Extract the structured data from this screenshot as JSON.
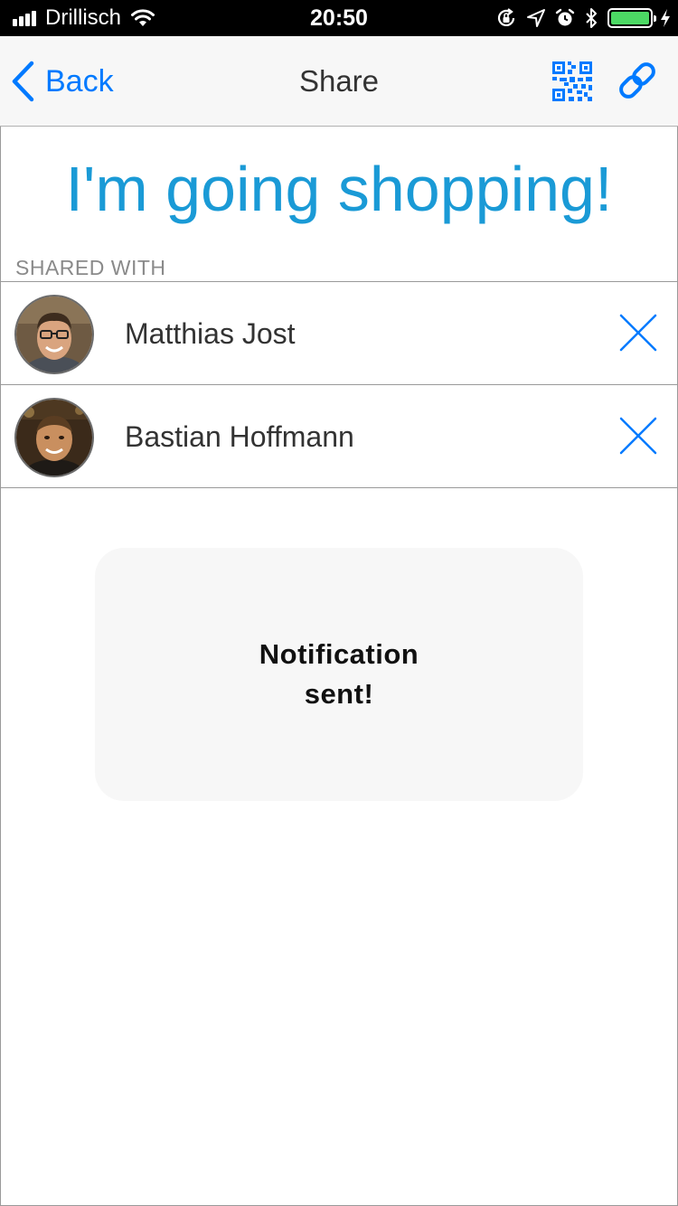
{
  "status_bar": {
    "carrier": "Drillisch",
    "time": "20:50",
    "signal_icon": "signal-bars-icon",
    "wifi_icon": "wifi-icon",
    "icons": [
      "orientation-lock-icon",
      "location-arrow-icon",
      "alarm-icon",
      "bluetooth-icon",
      "battery-icon",
      "charging-bolt-icon"
    ],
    "battery_level": 1.0,
    "battery_color": "#4cd964"
  },
  "nav": {
    "back_label": "Back",
    "title": "Share",
    "qr_icon": "qr-code-icon",
    "link_icon": "link-icon"
  },
  "list": {
    "title": "I'm going shopping!",
    "title_color": "#1a9ad6"
  },
  "shared_with": {
    "header": "SHARED WITH",
    "people": [
      {
        "name": "Matthias Jost",
        "avatar_icon": "avatar-photo",
        "remove_icon": "close-icon"
      },
      {
        "name": "Bastian Hoffmann",
        "avatar_icon": "avatar-photo",
        "remove_icon": "close-icon"
      }
    ]
  },
  "toast": {
    "message": "Notification sent!"
  },
  "colors": {
    "accent": "#007aff",
    "status_bar_bg": "#000000",
    "nav_bg": "#f7f7f7"
  }
}
